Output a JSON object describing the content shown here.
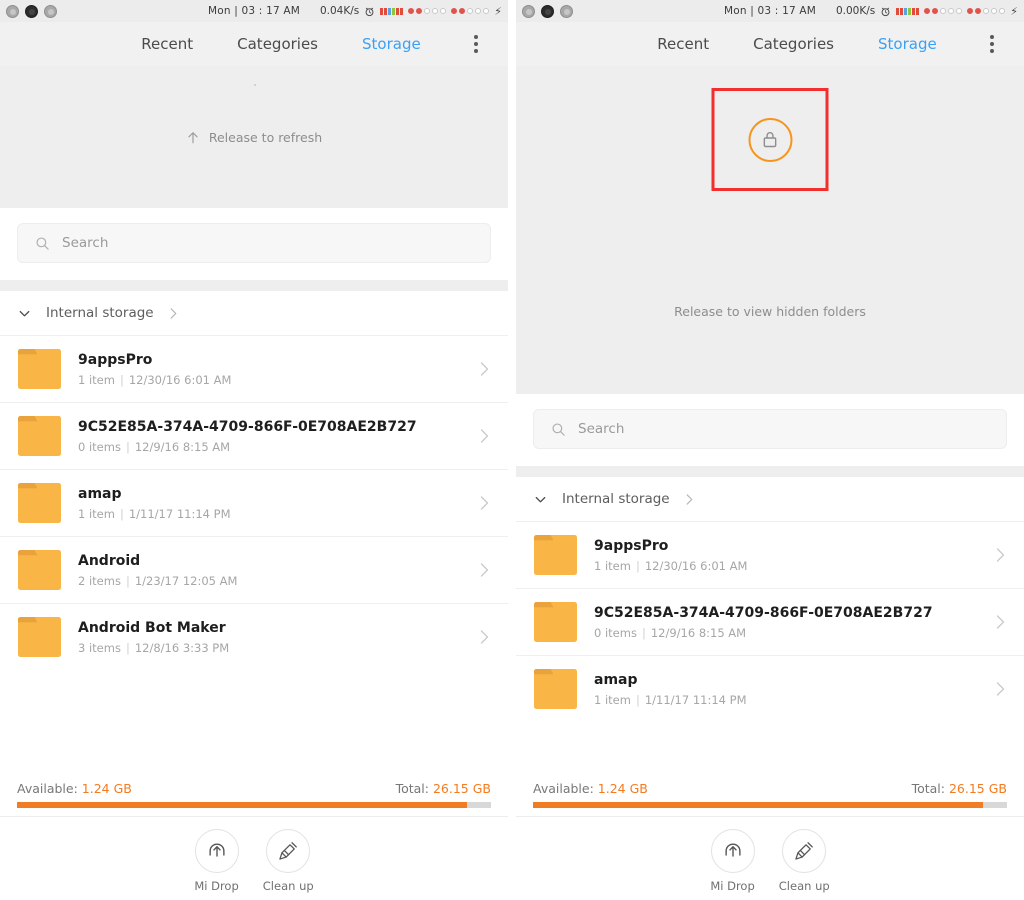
{
  "panels": [
    {
      "id": "left",
      "statusbar": {
        "clock": "Mon | 03 : 17 AM",
        "net_speed": "0.04K/s",
        "alarm_icon": "alarm-clock-icon",
        "battery_icon": "lightning-bolt-icon"
      },
      "tabs": [
        {
          "label": "Recent",
          "active": false
        },
        {
          "label": "Categories",
          "active": false
        },
        {
          "label": "Storage",
          "active": true
        }
      ],
      "overflow_menu": "more-options-icon",
      "refresh": {
        "text": "Release to refresh",
        "arrow_icon": "arrow-up-icon",
        "show_lock": false
      },
      "search": {
        "placeholder": "Search",
        "icon": "search-icon"
      },
      "breadcrumb": {
        "label": "Internal storage",
        "collapse_icon": "chevron-down-icon",
        "forward_icon": "chevron-right-icon"
      },
      "files": [
        {
          "name": "9appsPro",
          "count": "1 item",
          "date": "12/30/16 6:01 AM"
        },
        {
          "name": "9C52E85A-374A-4709-866F-0E708AE2B727",
          "count": "0 items",
          "date": "12/9/16 8:15 AM"
        },
        {
          "name": "amap",
          "count": "1 item",
          "date": "1/11/17 11:14 PM"
        },
        {
          "name": "Android",
          "count": "2 items",
          "date": "1/23/17 12:05 AM"
        },
        {
          "name": "Android Bot Maker",
          "count": "3 items",
          "date": "12/8/16 3:33 PM"
        }
      ],
      "storage": {
        "available_label": "Available:",
        "available_value": "1.24 GB",
        "total_label": "Total:",
        "total_value": "26.15 GB",
        "used_percent": 95
      },
      "toolbar": [
        {
          "label": "Mi Drop",
          "icon": "mi-drop-upload-icon"
        },
        {
          "label": "Clean up",
          "icon": "broom-clean-icon"
        }
      ]
    },
    {
      "id": "right",
      "statusbar": {
        "clock": "Mon | 03 : 17 AM",
        "net_speed": "0.00K/s",
        "alarm_icon": "alarm-clock-icon",
        "battery_icon": "lightning-bolt-icon"
      },
      "tabs": [
        {
          "label": "Recent",
          "active": false
        },
        {
          "label": "Categories",
          "active": false
        },
        {
          "label": "Storage",
          "active": true
        }
      ],
      "overflow_menu": "more-options-icon",
      "refresh": {
        "text": "Release to view hidden folders",
        "arrow_icon": "arrow-up-icon",
        "show_lock": true,
        "lock_icon": "padlock-icon",
        "highlight_color": "#f22e2e",
        "lock_ring_color": "#f7941d"
      },
      "search": {
        "placeholder": "Search",
        "icon": "search-icon"
      },
      "breadcrumb": {
        "label": "Internal storage",
        "collapse_icon": "chevron-down-icon",
        "forward_icon": "chevron-right-icon"
      },
      "files": [
        {
          "name": "9appsPro",
          "count": "1 item",
          "date": "12/30/16 6:01 AM"
        },
        {
          "name": "9C52E85A-374A-4709-866F-0E708AE2B727",
          "count": "0 items",
          "date": "12/9/16 8:15 AM"
        },
        {
          "name": "amap",
          "count": "1 item",
          "date": "1/11/17 11:14 PM"
        }
      ],
      "storage": {
        "available_label": "Available:",
        "available_value": "1.24 GB",
        "total_label": "Total:",
        "total_value": "26.15 GB",
        "used_percent": 95
      },
      "toolbar": [
        {
          "label": "Mi Drop",
          "icon": "mi-drop-upload-icon"
        },
        {
          "label": "Clean up",
          "icon": "broom-clean-icon"
        }
      ]
    }
  ],
  "colors": {
    "accent_blue": "#3ba0f5",
    "folder_orange": "#f9b545",
    "progress_orange": "#f07d23",
    "highlight_red": "#f22e2e",
    "lock_orange": "#f7941d"
  },
  "meta_separator": "|"
}
